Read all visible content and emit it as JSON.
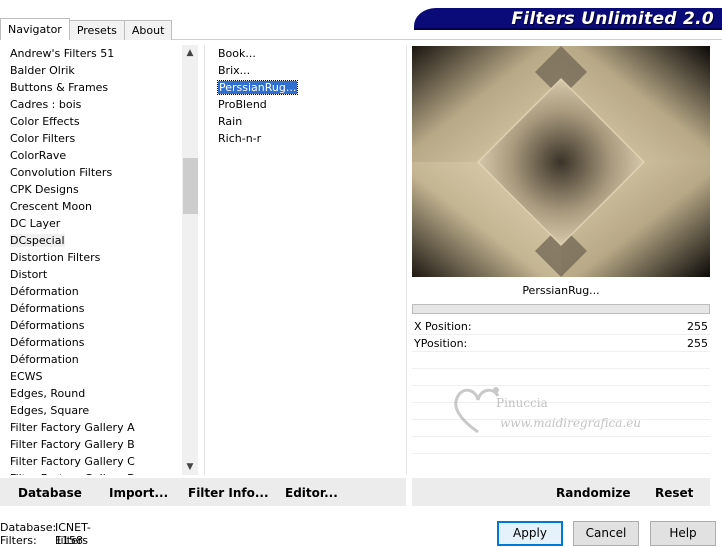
{
  "tabs": [
    {
      "label": "Navigator",
      "active": true
    },
    {
      "label": "Presets",
      "active": false
    },
    {
      "label": "About",
      "active": false
    }
  ],
  "banner": {
    "title": "Filters Unlimited 2.0"
  },
  "categories": [
    "Andrew's Filters 51",
    "Balder Olrik",
    "Buttons & Frames",
    "Cadres : bois",
    "Color Effects",
    "Color Filters",
    "ColorRave",
    "Convolution Filters",
    "CPK Designs",
    "Crescent Moon",
    "DC Layer",
    "DCspecial",
    "Distortion Filters",
    "Distort",
    "Déformation",
    "Déformations",
    "Déformations",
    "Déformations",
    "Déformation",
    "ECWS",
    "Edges, Round",
    "Edges, Square",
    "Filter Factory Gallery A",
    "Filter Factory Gallery B",
    "Filter Factory Gallery C",
    "Filter Factory Gallery D"
  ],
  "selected_category": "DCspecial",
  "filters": [
    "Book...",
    "Brix...",
    "PerssianRug...",
    "ProBlend",
    "Rain",
    "Rich-n-r"
  ],
  "selected_filter": "PerssianRug...",
  "preview": {
    "filter_name": "PerssianRug...",
    "progress": 0
  },
  "params": [
    {
      "label": "X Position:",
      "value": "255"
    },
    {
      "label": "YPosition:",
      "value": "255"
    }
  ],
  "watermark": {
    "line1": "Pinuccia",
    "line2": "www.maidiregrafica.eu"
  },
  "left_buttons": {
    "database": "Database",
    "import": "Import...",
    "filter_info": "Filter Info...",
    "editor": "Editor..."
  },
  "right_buttons": {
    "randomize": "Randomize",
    "reset": "Reset"
  },
  "status": {
    "database_label": "Database:",
    "database_value": "ICNET-Filters",
    "filters_label": "Filters:",
    "filters_value": "1158"
  },
  "dialog_buttons": {
    "apply": "Apply",
    "cancel": "Cancel",
    "help": "Help"
  },
  "colors": {
    "banner": "#0a0a78",
    "selection": "#2f6fd0",
    "default_button_border": "#0078d7"
  }
}
